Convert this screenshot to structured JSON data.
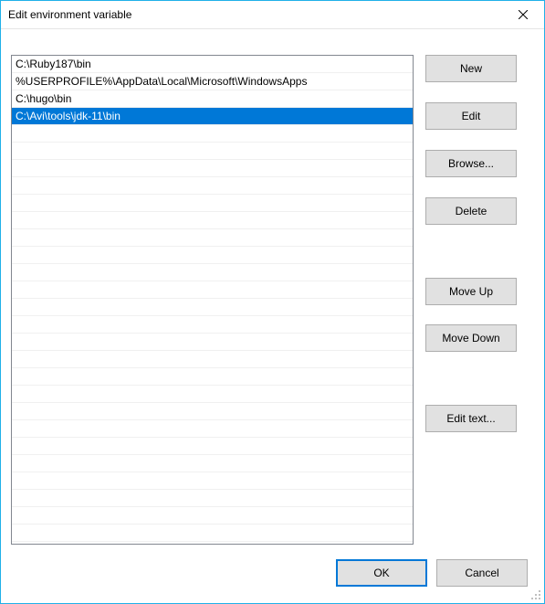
{
  "title": "Edit environment variable",
  "list": {
    "items": [
      "C:\\Ruby187\\bin",
      "%USERPROFILE%\\AppData\\Local\\Microsoft\\WindowsApps",
      "C:\\hugo\\bin",
      "C:\\Avi\\tools\\jdk-11\\bin"
    ],
    "selectedIndex": 3
  },
  "buttons": {
    "new": "New",
    "edit": "Edit",
    "browse": "Browse...",
    "delete": "Delete",
    "moveUp": "Move Up",
    "moveDown": "Move Down",
    "editText": "Edit text...",
    "ok": "OK",
    "cancel": "Cancel"
  }
}
